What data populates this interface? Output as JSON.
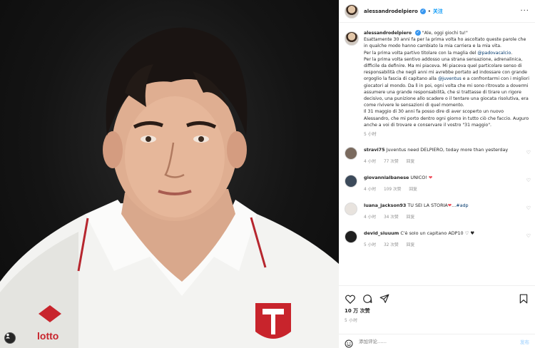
{
  "header": {
    "username": "alessandrodelpiero",
    "separator": "•",
    "follow_label": "关注",
    "more_label": "···"
  },
  "caption": {
    "username": "alessandrodelpiero",
    "paragraphs": [
      "\"Ale, oggi giochi tu!\"",
      "Esattamente 30 anni fa per la prima volta ho ascoltato queste parole che in qualche modo hanno cambiato la mia carriera e la mia vita.",
      "Per la prima volta partivo titolare con la maglia del ",
      "Per la prima volta sentivo addosso una strana sensazione, adrenalinica, difficile da definire. Ma mi piaceva. Mi piaceva quel particolare senso di responsabilità che negli anni mi avrebbe portato ad indossare con grande orgoglio la fascia di capitano alla ",
      " e a confrontarmi con i migliori giocatori al mondo. Da lì in poi, ogni volta che mi sono ritrovato a dovermi assumere una grande responsabilità, che si trattasse di tirare un rigore decisivo, una punizione allo scadere o il tentare una giocata risolutiva, era come rivivere le sensazioni di quel momento.",
      "Il 31 maggio di 30 anni fa posso dire di aver scoperto un nuovo Alessandro, che mi porto dentro ogni giorno in tutto ciò che faccio. Auguro anche a voi di trovare e conservare il vostro \"31 maggio\"."
    ],
    "mention_padova": "@padovacalcio",
    "period": ".",
    "mention_juventus": "@juventus",
    "time": "5 小时"
  },
  "comments": [
    {
      "username": "stravi75",
      "text": "Juventus need DELPIERO, today more than yesterday",
      "time": "4 小时",
      "likes": "77 次赞",
      "reply": "回复"
    },
    {
      "username": "giovannialbanese",
      "text": "UNICO!",
      "emoji": "❤",
      "time": "4 小时",
      "likes": "109 次赞",
      "reply": "回复"
    },
    {
      "username": "luana_jackson93",
      "text": "TU SEI LA STORIA",
      "emoji": "❤",
      "text_after": "...",
      "hashtag": "#adp",
      "time": "4 小时",
      "likes": "34 次赞",
      "reply": "回复"
    },
    {
      "username": "devid_siuuum",
      "text": "C'è solo un capitano ADP10",
      "emoji": "♡ ♥",
      "time": "5 小时",
      "likes": "32 次赞",
      "reply": "回复"
    }
  ],
  "post": {
    "likes": "10 万 次赞",
    "time": "5 小时"
  },
  "add_comment": {
    "placeholder": "添加评论……",
    "post_label": "发布"
  },
  "colors": {
    "accent": "#0095f6",
    "verified": "#3897f0",
    "heart": "#ed4956",
    "mention": "#00376b",
    "muted": "#8e8e8e"
  }
}
